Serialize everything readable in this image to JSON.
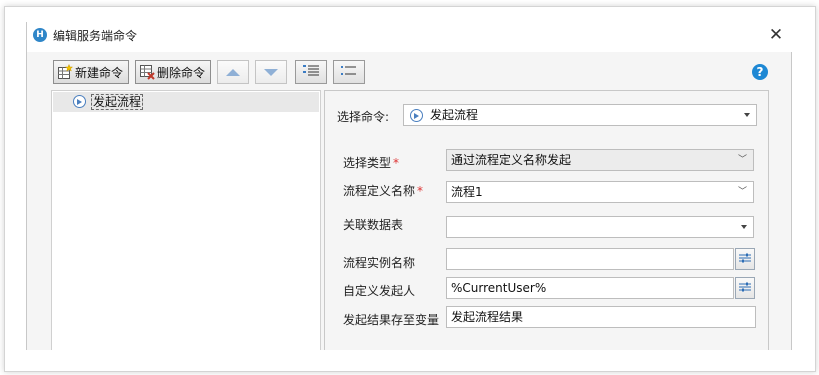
{
  "window": {
    "title": "编辑服务端命令",
    "close_glyph": "✕",
    "app_icon_letter": "H"
  },
  "toolbar": {
    "new_command_label": "新建命令",
    "delete_command_label": "删除命令",
    "help_glyph": "?"
  },
  "tree": {
    "items": [
      {
        "label": "发起流程"
      }
    ]
  },
  "form": {
    "select_command": {
      "label": "选择命令:",
      "value": "发起流程"
    },
    "select_type": {
      "label": "选择类型",
      "value": "通过流程定义名称发起",
      "required_mark": "*"
    },
    "flow_definition_name": {
      "label": "流程定义名称",
      "value": "流程1",
      "required_mark": "*"
    },
    "related_table": {
      "label": "关联数据表",
      "value": ""
    },
    "flow_instance_name": {
      "label": "流程实例名称",
      "value": ""
    },
    "custom_initiator": {
      "label": "自定义发起人",
      "value": "%CurrentUser%"
    },
    "result_variable": {
      "label": "发起结果存至变量",
      "value": "发起流程结果"
    }
  },
  "colors": {
    "accent_blue": "#1e88d4",
    "required_red": "#d33333",
    "arrow_disabled": "#8fb0d6"
  }
}
